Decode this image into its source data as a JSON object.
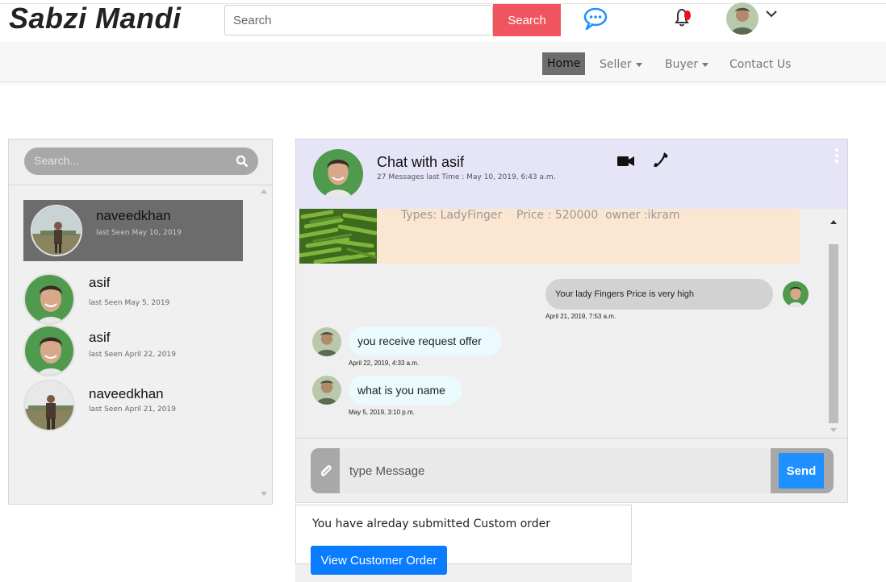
{
  "header": {
    "logo": "Sabzi Mandi",
    "search_placeholder": "Search",
    "search_button": "Search",
    "icons": [
      "chat-bubble-icon",
      "bell-icon",
      "user-avatar",
      "chevron-down-icon"
    ],
    "notification_color": "#e8101f"
  },
  "nav": {
    "items": [
      {
        "label": "Home",
        "active": true
      },
      {
        "label": "Seller",
        "dropdown": true
      },
      {
        "label": "Buyer",
        "dropdown": true
      },
      {
        "label": "Contact Us"
      }
    ]
  },
  "contacts": {
    "search_placeholder": "Search...",
    "items": [
      {
        "name": "naveedkhan",
        "seen": "last Seen May 10, 2019",
        "active": true
      },
      {
        "name": "asif",
        "seen": "last Seen May 5, 2019"
      },
      {
        "name": "asif",
        "seen": "last Seen April 22, 2019"
      },
      {
        "name": "naveedkhan",
        "seen": "last Seen April 21, 2019"
      }
    ]
  },
  "chat": {
    "title": "Chat with asif",
    "subtitle": "27 Messages last Time : May 10, 2019, 6:43 a.m.",
    "product": {
      "text": "Types: LadyFinger    Price : 520000  owner :ikram"
    },
    "messages": [
      {
        "direction": "out",
        "text": "Your lady Fingers Price is very high",
        "time": "April 21, 2019, 7:53 a.m."
      },
      {
        "direction": "in",
        "text": "you receive request offer",
        "time": "April 22, 2019, 4:33 a.m."
      },
      {
        "direction": "in",
        "text": "what is you name",
        "time": "May 5, 2019, 3:10 p.m."
      }
    ],
    "composer_placeholder": "type Message",
    "send_label": "Send"
  },
  "order": {
    "message": "You have alreday submitted Custom order",
    "button": "View Customer Order"
  },
  "colors": {
    "accent_red": "#f0555f",
    "send_blue": "#1e90ff",
    "order_blue": "#0a7cff",
    "header_lavender": "#e5e5f7",
    "product_peach": "#fbe6d2",
    "active_contact": "#6c6c6c"
  }
}
